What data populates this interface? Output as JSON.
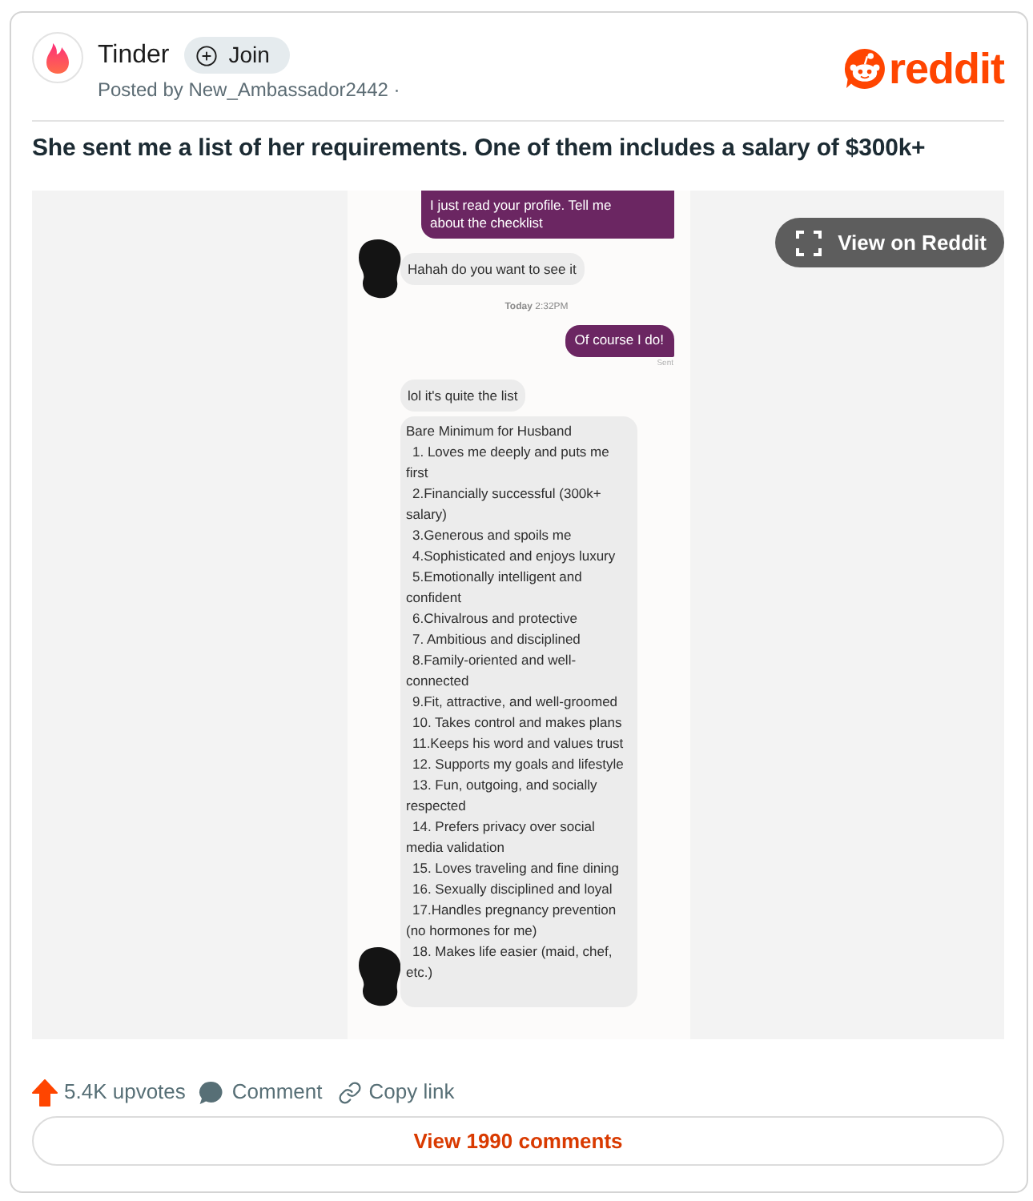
{
  "post": {
    "community": "Tinder",
    "join_label": "Join",
    "posted_by": "Posted by New_Ambassador2442 ·",
    "brand": "reddit",
    "title": "She sent me a list of her requirements. One of them includes a salary of $300k+"
  },
  "media": {
    "view_button": "View on Reddit",
    "messages": [
      {
        "kind": "sent",
        "text": "I just read your profile. Tell me about the checklist"
      },
      {
        "kind": "received",
        "text": "Hahah do you want to see it",
        "avatar": true
      },
      {
        "kind": "timestamp",
        "text": "**Today** 2:32PM"
      },
      {
        "kind": "sent",
        "text": "Of course I do!"
      },
      {
        "kind": "status",
        "text": "Sent"
      },
      {
        "kind": "received",
        "text": "lol it's quite the list",
        "avatar": false
      },
      {
        "kind": "list",
        "title": "Bare Minimum for Husband",
        "avatar": true,
        "items": [
          "1. Loves me deeply and puts me first",
          "2.Financially successful (300k+ salary)",
          "3.Generous and spoils me",
          "4.Sophisticated and enjoys luxury",
          "5.Emotionally intelligent and confident",
          "6.Chivalrous and protective",
          "7. Ambitious and disciplined",
          "8.Family-oriented and well-connected",
          "9.Fit, attractive, and well-groomed",
          "10. Takes control and makes plans",
          "11.Keeps his word and values trust",
          "12. Supports my goals and lifestyle",
          "13. Fun, outgoing, and socially respected",
          "14. Prefers privacy over social media validation",
          "15. Loves traveling and fine dining",
          "16. Sexually disciplined and loyal",
          "17.Handles pregnancy prevention (no hormones for me)",
          "18. Makes life easier (maid, chef, etc.)"
        ]
      }
    ]
  },
  "actions": {
    "upvotes": "5.4K upvotes",
    "comment": "Comment",
    "copy_link": "Copy link"
  },
  "view_comments": "View 1990 comments"
}
